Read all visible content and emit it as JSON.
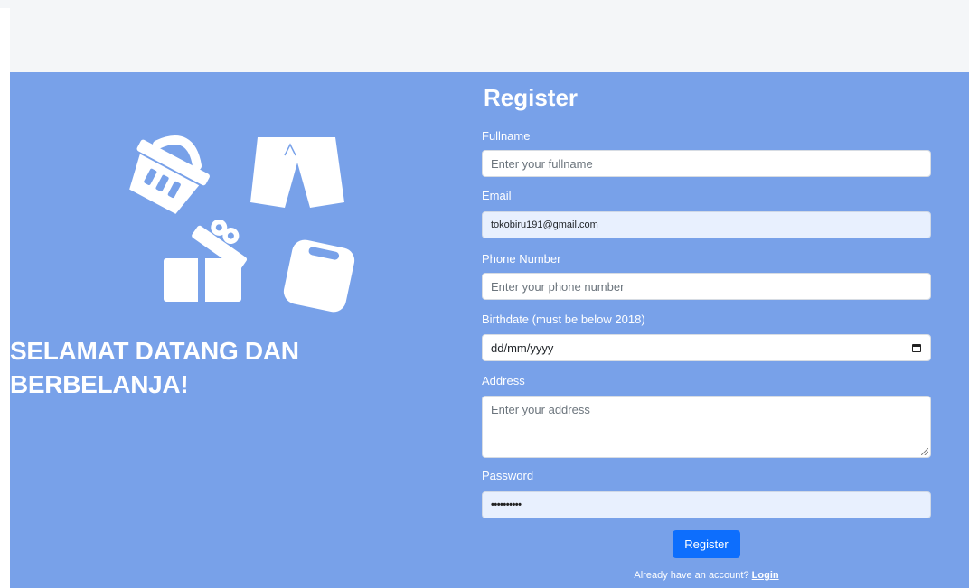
{
  "welcome": {
    "line1": "SELAMAT DATANG DAN",
    "line2": "BERBELANJA!"
  },
  "form": {
    "title": "Register",
    "fullname": {
      "label": "Fullname",
      "placeholder": "Enter your fullname",
      "value": ""
    },
    "email": {
      "label": "Email",
      "value": "tokobiru191@gmail.com"
    },
    "phone": {
      "label": "Phone Number",
      "placeholder": "Enter your phone number",
      "value": ""
    },
    "birthdate": {
      "label": "Birthdate (must be below 2018)",
      "value": "dd/mm/yyyy"
    },
    "address": {
      "label": "Address",
      "placeholder": "Enter your address",
      "value": ""
    },
    "password": {
      "label": "Password",
      "masked_value": "••••••••••"
    },
    "submit_label": "Register",
    "login_prompt": "Already have an account?",
    "login_link": "Login"
  },
  "colors": {
    "panel_bg": "#78a1e9",
    "button_bg": "#0d6efd",
    "autofill_bg": "#e8f0fe"
  },
  "icons": [
    "shopping-basket-icon",
    "shorts-icon",
    "gift-box-icon",
    "shopping-bag-icon",
    "calendar-icon"
  ]
}
